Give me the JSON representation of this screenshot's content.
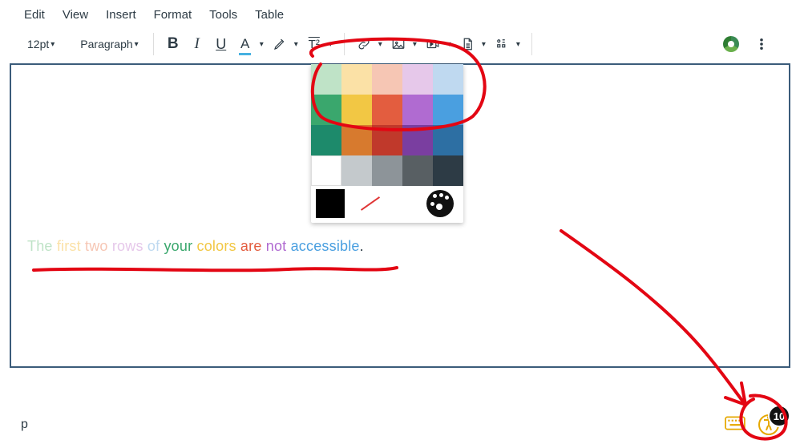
{
  "menu": {
    "edit": "Edit",
    "view": "View",
    "insert": "Insert",
    "format": "Format",
    "tools": "Tools",
    "table": "Table"
  },
  "toolbar": {
    "font_size": "12pt",
    "block": "Paragraph",
    "bold": "B",
    "italic": "I",
    "underline": "U",
    "text_color_label": "A",
    "super_label": "T²"
  },
  "color_picker": {
    "rows": [
      [
        "#bfe3c7",
        "#fbe1a6",
        "#f6c6b4",
        "#e6c8ea",
        "#bfd9f0"
      ],
      [
        "#3aa76d",
        "#f2c744",
        "#e35d3f",
        "#b06bd1",
        "#4a9fe0"
      ],
      [
        "#1d8a6b",
        "#d77a2e",
        "#c0392b",
        "#7a3ea0",
        "#2d6fa3"
      ],
      [
        "#ffffff",
        "#c4c9cc",
        "#8d9499",
        "#585f63",
        "#2d3b45"
      ]
    ],
    "final": {
      "black": "#000000"
    }
  },
  "content_words": [
    {
      "t": "The",
      "c": "#bfe3c7"
    },
    {
      "t": " first",
      "c": "#fbe1a6"
    },
    {
      "t": " two",
      "c": "#f6c6b4"
    },
    {
      "t": " rows",
      "c": "#e6c8ea"
    },
    {
      "t": " of",
      "c": "#bfd9f0"
    },
    {
      "t": " your",
      "c": "#3aa76d"
    },
    {
      "t": " colors",
      "c": "#f2c744"
    },
    {
      "t": " are",
      "c": "#e35d3f"
    },
    {
      "t": " not",
      "c": "#b06bd1"
    },
    {
      "t": " accessible",
      "c": "#4a9fe0"
    },
    {
      "t": ".",
      "c": "#2d3b45"
    }
  ],
  "status": {
    "path": "p",
    "a11y_count": "10"
  },
  "colors": {
    "annotation": "#e30613"
  }
}
